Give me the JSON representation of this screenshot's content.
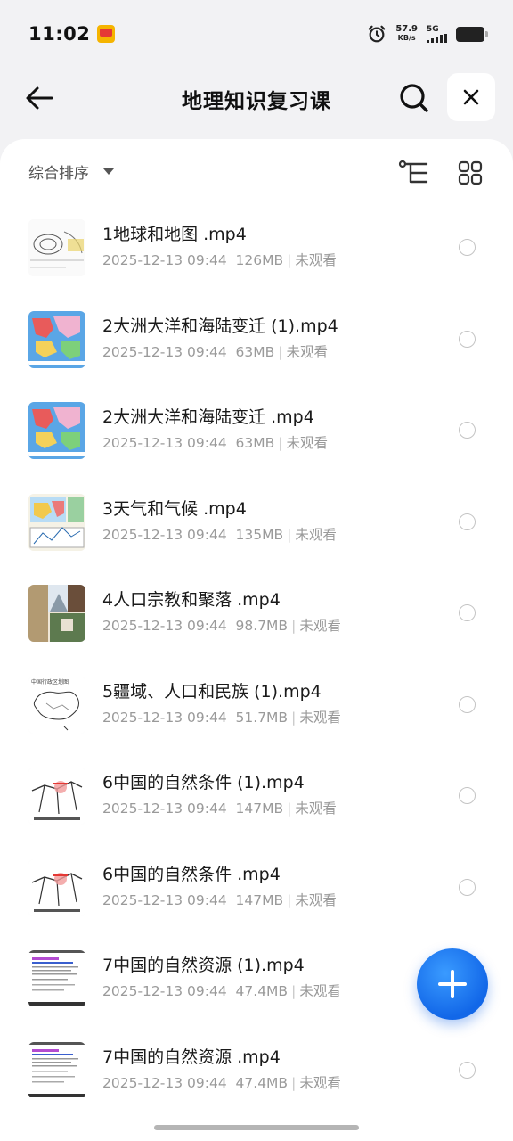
{
  "status_bar": {
    "time": "11:02",
    "net_speed_value": "57.9",
    "net_speed_unit": "KB/s",
    "network_type": "5G"
  },
  "header": {
    "title": "地理知识复习课"
  },
  "toolbar": {
    "sort_label": "综合排序"
  },
  "files": [
    {
      "name": "1地球和地图 .mp4",
      "date": "2025-12-13 09:44",
      "size": "126MB",
      "status": "未观看",
      "thumb": "map-sketch"
    },
    {
      "name": "2大洲大洋和海陆变迁 (1).mp4",
      "date": "2025-12-13 09:44",
      "size": "63MB",
      "status": "未观看",
      "thumb": "plates-map"
    },
    {
      "name": "2大洲大洋和海陆变迁 .mp4",
      "date": "2025-12-13 09:44",
      "size": "63MB",
      "status": "未观看",
      "thumb": "plates-map"
    },
    {
      "name": "3天气和气候 .mp4",
      "date": "2025-12-13 09:44",
      "size": "135MB",
      "status": "未观看",
      "thumb": "climate-map"
    },
    {
      "name": "4人口宗教和聚落 .mp4",
      "date": "2025-12-13 09:44",
      "size": "98.7MB",
      "status": "未观看",
      "thumb": "photos"
    },
    {
      "name": "5疆域、人口和民族 (1).mp4",
      "date": "2025-12-13 09:44",
      "size": "51.7MB",
      "status": "未观看",
      "thumb": "china-outline"
    },
    {
      "name": "6中国的自然条件 (1).mp4",
      "date": "2025-12-13 09:44",
      "size": "147MB",
      "status": "未观看",
      "thumb": "rail-map"
    },
    {
      "name": "6中国的自然条件 .mp4",
      "date": "2025-12-13 09:44",
      "size": "147MB",
      "status": "未观看",
      "thumb": "rail-map"
    },
    {
      "name": "7中国的自然资源 (1).mp4",
      "date": "2025-12-13 09:44",
      "size": "47.4MB",
      "status": "未观看",
      "thumb": "doc-page"
    },
    {
      "name": "7中国的自然资源 .mp4",
      "date": "2025-12-13 09:44",
      "size": "47.4MB",
      "status": "未观看",
      "thumb": "doc-page"
    }
  ],
  "colors": {
    "accent": "#1a73e8",
    "background": "#f2f2f4",
    "sheet": "#ffffff",
    "meta_text": "#9a9a9a"
  },
  "icons": {
    "back": "arrow-left-icon",
    "search": "search-icon",
    "close": "close-icon",
    "sort": "caret-down-icon",
    "tree": "tree-view-icon",
    "grid": "grid-view-icon",
    "add": "plus-icon"
  }
}
